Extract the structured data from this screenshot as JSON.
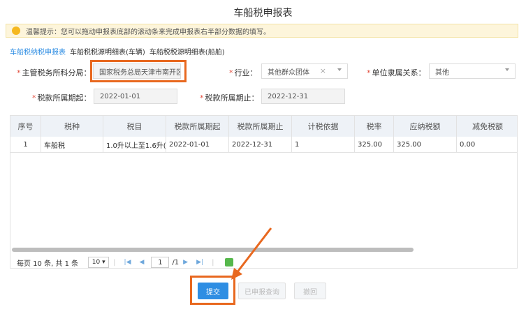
{
  "page": {
    "title": "车船税申报表"
  },
  "notice": {
    "text": "温馨提示：您可以拖动申报表底部的滚动条来完成申报表右半部分数据的填写。"
  },
  "tabs": [
    {
      "label": "车船税纳税申报表"
    },
    {
      "label": "车船税税源明细表(车辆)"
    },
    {
      "label": "车船税税源明细表(船舶)"
    }
  ],
  "form": {
    "tax_office_label": "主管税务所科分局：",
    "tax_office_value": "国家税务总局天津市南开区税",
    "industry_label": "行业：",
    "industry_value": "其他群众团体",
    "clear_symbol": "×",
    "unit_relation_label": "单位隶属关系：",
    "unit_relation_value": "其他",
    "period_start_label": "税款所属期起：",
    "period_start_value": "2022-01-01",
    "period_end_label": "税款所属期止：",
    "period_end_value": "2022-12-31"
  },
  "table": {
    "headers": [
      "序号",
      "税种",
      "税目",
      "税款所属期起",
      "税款所属期止",
      "计税依据",
      "税率",
      "应纳税额",
      "减免税额"
    ],
    "rows": [
      [
        "1",
        "车船税",
        "1.0升以上至1.6升(...",
        "2022-01-01",
        "2022-12-31",
        "1",
        "325.00",
        "325.00",
        "0.00"
      ]
    ]
  },
  "pager": {
    "summary": "每页 10 条, 共 1 条",
    "page_size": "10",
    "current_page": "1",
    "total_pages": "/1"
  },
  "buttons": {
    "submit": "提交",
    "query": "已申报查询",
    "withdraw": "撤回"
  },
  "colors": {
    "accent": "#2f8ee3",
    "highlight": "#e8681f",
    "required": "#e24b3b"
  }
}
